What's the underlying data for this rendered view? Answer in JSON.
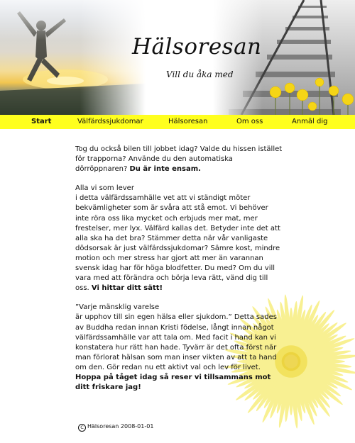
{
  "header": {
    "title": "Hälsoresan",
    "tagline": "Vill du åka med",
    "colors": {
      "nav_bg": "#ffff1e",
      "sunset": "#f0c84a",
      "flower": "#f3e43a"
    }
  },
  "nav": {
    "items": [
      {
        "label": "Start",
        "active": true
      },
      {
        "label": "Välfärdssjukdomar",
        "active": false
      },
      {
        "label": "Hälsoresan",
        "active": false
      },
      {
        "label": "Om oss",
        "active": false
      },
      {
        "label": "Anmäl dig",
        "active": false
      }
    ]
  },
  "intro": {
    "text": "Tog du också bilen till jobbet idag? Valde du hissen istället för trapporna? Använde du den automatiska dörröppnaren? ",
    "bold": "Du är inte ensam."
  },
  "section2": {
    "heading": "Alla vi som lever",
    "text": "i detta välfärdssamhälle vet att vi ständigt möter bekvämligheter som är svåra att stå emot. Vi behöver inte röra oss lika mycket och erbjuds mer mat, mer frestelser, mer lyx. Välfärd kallas det. Betyder inte det att alla ska ha det bra? Stämmer detta när vår vanligaste dödsorsak är just välfärdssjukdomar? Sämre kost, mindre motion och mer stress har gjort att mer än varannan svensk idag har för höga blodfetter. Du med? Om du vill vara med att förändra och börja leva rätt, vänd dig till oss. ",
    "bold": "Vi hittar ditt sätt!"
  },
  "section3": {
    "heading": "”Varje mänsklig varelse",
    "text": "är upphov till sin egen hälsa eller sjukdom.” Detta sades av Buddha redan innan Kristi födelse, långt innan något välfärdssamhälle var att tala om. Med facit i hand kan vi konstatera hur rätt han hade. Tyvärr är det ofta först när man förlorat hälsan som man inser vikten av att ta hand om den. Gör redan nu ett aktivt val och lev för livet. ",
    "bold": "Hoppa på tåget idag så reser vi tillsammans mot ditt friskare jag!"
  },
  "footer": {
    "copyright_symbol": "C",
    "text": "Hälsoresan 2008-01-01"
  }
}
